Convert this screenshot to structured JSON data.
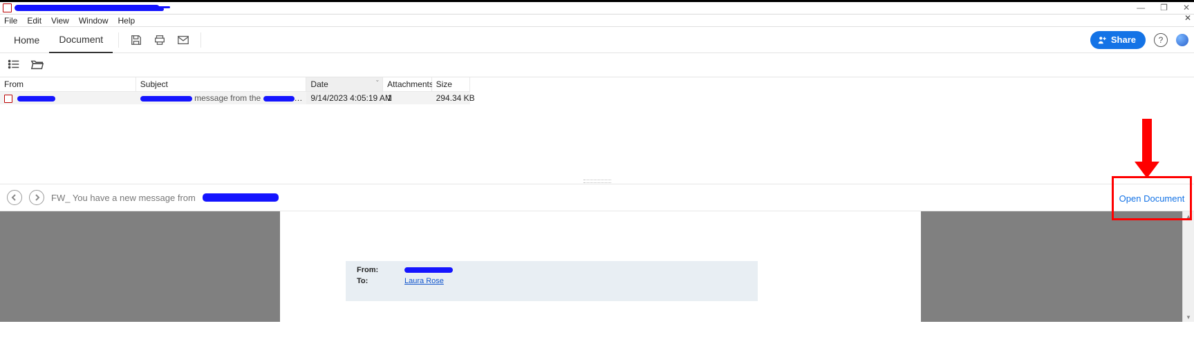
{
  "window": {
    "title_redacted": true,
    "controls": {
      "minimize": "—",
      "maximize": "❐",
      "close": "✕"
    },
    "secondary_close": "✕"
  },
  "menu": {
    "file": "File",
    "edit": "Edit",
    "view": "View",
    "window": "Window",
    "help": "Help"
  },
  "tabs": {
    "home": "Home",
    "document": "Document"
  },
  "toolbar": {
    "share_label": "Share",
    "help_glyph": "?"
  },
  "columns": {
    "from": "From",
    "subject": "Subject",
    "date": "Date",
    "attachments": "Attachments",
    "size": "Size"
  },
  "rows": [
    {
      "from_redacted": true,
      "subject_partial": "message from the",
      "date": "9/14/2023 4:05:19 AM",
      "attachments": "1",
      "size": "294.34 KB"
    }
  ],
  "nav": {
    "subject_prefix": "FW_ You have a new message from",
    "open_document": "Open Document"
  },
  "email_preview": {
    "from_label": "From:",
    "from_redacted": true,
    "to_label": "To:",
    "to_value": "Laura Rose"
  }
}
